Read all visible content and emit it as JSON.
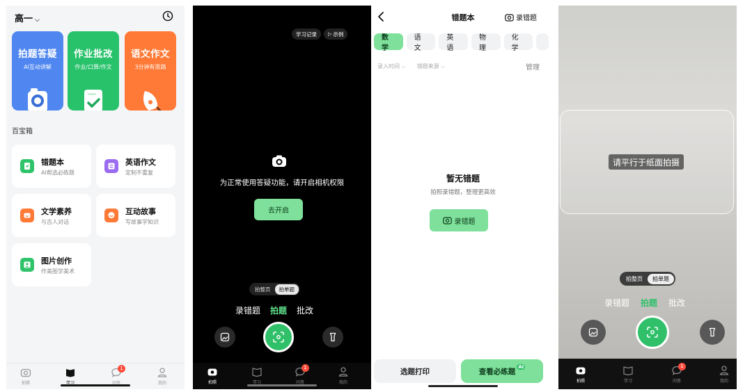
{
  "screen1": {
    "grade": "高一",
    "big_cards": [
      {
        "title": "拍题答疑",
        "sub": "AI互动讲解",
        "color": "#4f86f0"
      },
      {
        "title": "作业批改",
        "sub": "作业/口算/作文",
        "color": "#28c26b"
      },
      {
        "title": "语文作文",
        "sub": "3分钟有思路",
        "color": "#ff7a36"
      }
    ],
    "section": "百宝箱",
    "tools": [
      {
        "title": "错题本",
        "sub": "AI帮选必练题",
        "color": "#2fc46a"
      },
      {
        "title": "英语作文",
        "sub": "定制不重复",
        "color": "#9b6cf0"
      },
      {
        "title": "文学素养",
        "sub": "与古人对话",
        "color": "#ff7a36"
      },
      {
        "title": "互动故事",
        "sub": "写故事学知识",
        "color": "#ff7a36"
      },
      {
        "title": "图片创作",
        "sub": "作美图学美术",
        "color": "#2fc46a"
      }
    ],
    "tabs": [
      "拍照",
      "学习",
      "问答",
      "我的"
    ],
    "badge": "1"
  },
  "screen2": {
    "top_pills": [
      "学习记录",
      "示例"
    ],
    "permission_text": "为正常使用答疑功能，请开启相机权限",
    "open_button": "去开启",
    "segments": [
      "拍整页",
      "拍单题"
    ],
    "modes": [
      "录错题",
      "拍题",
      "批改"
    ],
    "tabs": [
      "拍照",
      "学习",
      "问答",
      "我的"
    ],
    "badge": "1"
  },
  "screen3": {
    "title": "错题本",
    "record_label": "录错题",
    "subjects": [
      "数学",
      "语文",
      "英语",
      "物理",
      "化学"
    ],
    "filters": [
      "录入时间",
      "错题来源"
    ],
    "manage": "管理",
    "empty_title": "暂无错题",
    "empty_sub": "拍照录错题，整理更高效",
    "record_button": "录错题",
    "print_button": "选题打印",
    "practice_button": "查看必练题",
    "ai_tag": "AI"
  },
  "screen4": {
    "hint": "请平行于纸面拍摄",
    "segments": [
      "拍整页",
      "拍单题"
    ],
    "modes": [
      "录错题",
      "拍题",
      "批改"
    ],
    "tabs": [
      "拍照",
      "学习",
      "问答",
      "我的"
    ],
    "badge": "1"
  },
  "colors": {
    "accent": "#7ee09a",
    "accent_text": "#31c06a",
    "badge": "#ff4d3d"
  }
}
